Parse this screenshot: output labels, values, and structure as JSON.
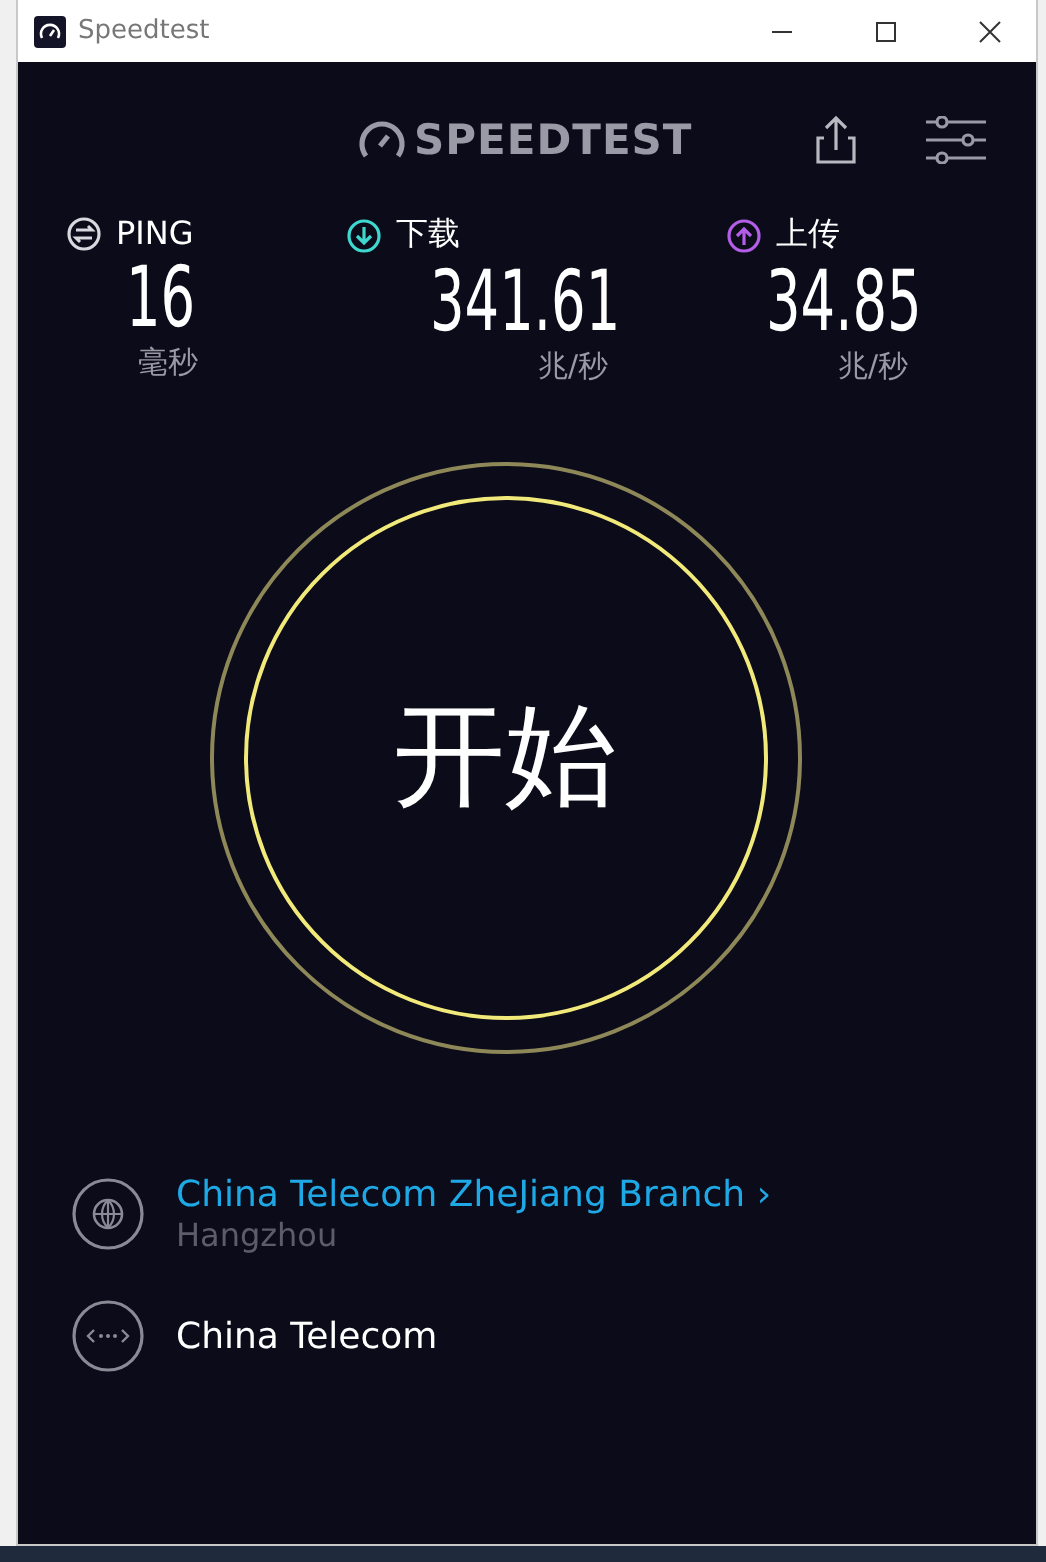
{
  "window": {
    "title": "Speedtest"
  },
  "header": {
    "logo": "SPEEDTEST"
  },
  "metrics": [
    {
      "kind": "ping",
      "label": "PING",
      "value": "16",
      "unit": "毫秒"
    },
    {
      "kind": "download",
      "label": "下载",
      "value": "341.61",
      "unit": "兆/秒"
    },
    {
      "kind": "upload",
      "label": "上传",
      "value": "34.85",
      "unit": "兆/秒"
    }
  ],
  "start_button": {
    "label": "开始"
  },
  "server": {
    "name": "China Telecom ZheJiang Branch",
    "arrow": "›",
    "location": "Hangzhou"
  },
  "provider": {
    "name": "China Telecom"
  }
}
